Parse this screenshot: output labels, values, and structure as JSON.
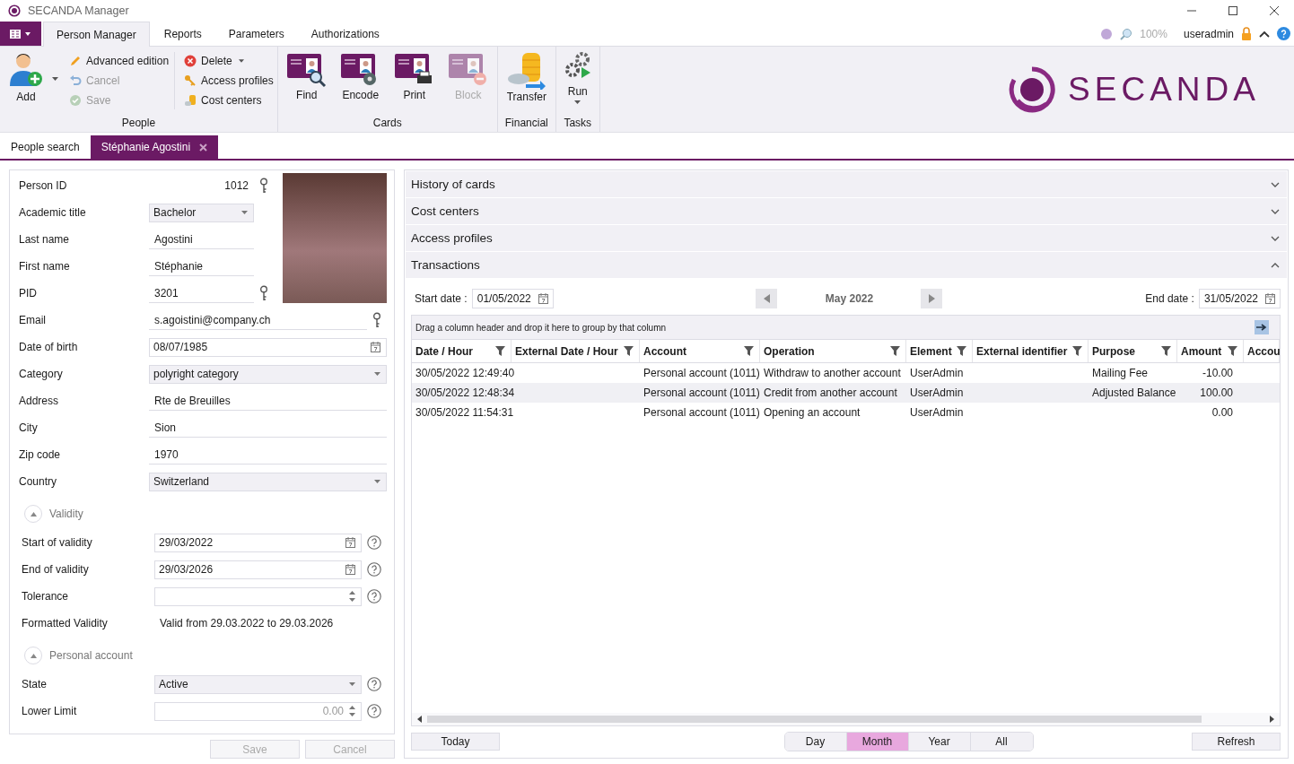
{
  "window": {
    "title": "SECANDA Manager"
  },
  "menu_tabs": [
    {
      "label": "Person Manager",
      "selected": true
    },
    {
      "label": "Reports",
      "selected": false
    },
    {
      "label": "Parameters",
      "selected": false
    },
    {
      "label": "Authorizations",
      "selected": false
    }
  ],
  "status": {
    "zoom": "100%",
    "user": "useradmin"
  },
  "ribbon": {
    "people": {
      "title": "People",
      "add": "Add",
      "actions": [
        {
          "label": "Advanced edition",
          "disabled": false
        },
        {
          "label": "Cancel",
          "disabled": true
        },
        {
          "label": "Save",
          "disabled": true
        }
      ],
      "actions2": [
        {
          "label": "Delete",
          "dropdown": true
        },
        {
          "label": "Access profiles",
          "dropdown": false
        },
        {
          "label": "Cost centers",
          "dropdown": false
        }
      ]
    },
    "cards": {
      "title": "Cards",
      "buttons": [
        {
          "label": "Find",
          "disabled": false
        },
        {
          "label": "Encode",
          "disabled": false
        },
        {
          "label": "Print",
          "disabled": false
        },
        {
          "label": "Block",
          "disabled": true
        }
      ]
    },
    "financial": {
      "title": "Financial",
      "button": "Transfer"
    },
    "tasks": {
      "title": "Tasks",
      "button": "Run"
    }
  },
  "logo": {
    "text": "SECANDA"
  },
  "doc_tabs": [
    {
      "label": "People search",
      "selected": false,
      "closable": false
    },
    {
      "label": "Stéphanie Agostini",
      "selected": true,
      "closable": true
    }
  ],
  "identity_fields": [
    {
      "label": "Person ID",
      "kind": "static",
      "value": "1012",
      "key": true
    },
    {
      "label": "Academic title",
      "kind": "combo",
      "value": "Bachelor",
      "key": false
    },
    {
      "label": "Last name",
      "kind": "text",
      "value": "Agostini",
      "key": false
    },
    {
      "label": "First name",
      "kind": "text",
      "value": "Stéphanie",
      "key": false
    },
    {
      "label": "PID",
      "kind": "text",
      "value": "3201",
      "key": true
    }
  ],
  "fields": [
    {
      "label": "Email",
      "kind": "text",
      "value": "s.agoistini@company.ch",
      "key": true
    },
    {
      "label": "Date of birth",
      "kind": "date",
      "value": "08/07/1985",
      "key": false
    },
    {
      "label": "Category",
      "kind": "combo",
      "value": "polyright category",
      "key": false
    },
    {
      "label": "Address",
      "kind": "text",
      "value": "Rte de Breuilles",
      "key": false
    },
    {
      "label": "City",
      "kind": "text",
      "value": "Sion",
      "key": false
    },
    {
      "label": "Zip code",
      "kind": "text",
      "value": "1970",
      "key": false
    },
    {
      "label": "Country",
      "kind": "combo",
      "value": "Switzerland",
      "key": false
    }
  ],
  "sections": [
    {
      "title": "Validity",
      "expanded": true,
      "fields": [
        {
          "label": "Start of validity",
          "kind": "date",
          "value": "29/03/2022",
          "help": true
        },
        {
          "label": "End of validity",
          "kind": "date",
          "value": "29/03/2026",
          "help": true
        },
        {
          "label": "Tolerance",
          "kind": "spin",
          "help": true
        },
        {
          "label": "Formatted Validity",
          "kind": "display",
          "value": "Valid from 29.03.2022 to 29.03.2026",
          "help": false
        }
      ]
    },
    {
      "title": "Personal account",
      "expanded": true,
      "fields": [
        {
          "label": "State",
          "kind": "combo",
          "value": "Active",
          "help": true
        },
        {
          "label": "Lower Limit",
          "kind": "spin",
          "placeholder": "0.00",
          "help": true
        }
      ]
    }
  ],
  "form_buttons": [
    {
      "label": "Save",
      "disabled": true
    },
    {
      "label": "Cancel",
      "disabled": true
    }
  ],
  "panels": [
    {
      "title": "History of cards",
      "expanded": false
    },
    {
      "title": "Cost centers",
      "expanded": false
    },
    {
      "title": "Access profiles",
      "expanded": false
    },
    {
      "title": "Transactions",
      "expanded": true
    }
  ],
  "transactions": {
    "start_label": "Start date :",
    "start_date": "01/05/2022",
    "period": "May 2022",
    "end_label": "End date :",
    "end_date": "31/05/2022",
    "group_hint": "Drag a column header and drop it here to group by that column",
    "columns": [
      "Date / Hour",
      "External Date / Hour",
      "Account",
      "Operation",
      "Element",
      "External identifier",
      "Purpose",
      "Amount",
      "Accou"
    ],
    "rows": [
      [
        "30/05/2022 12:49:40",
        "",
        "Personal account (1011)",
        "Withdraw to another account",
        "UserAdmin",
        "",
        "Mailing Fee",
        "-10.00",
        ""
      ],
      [
        "30/05/2022 12:48:34",
        "",
        "Personal account (1011)",
        "Credit from another account",
        "UserAdmin",
        "",
        "Adjusted Balance",
        "100.00",
        ""
      ],
      [
        "30/05/2022 11:54:31",
        "",
        "Personal account (1011)",
        "Opening an account",
        "UserAdmin",
        "",
        "",
        "0.00",
        ""
      ]
    ],
    "today": "Today",
    "periods": [
      {
        "label": "Day",
        "selected": false
      },
      {
        "label": "Month",
        "selected": true
      },
      {
        "label": "Year",
        "selected": false
      },
      {
        "label": "All",
        "selected": false
      }
    ],
    "refresh": "Refresh"
  }
}
